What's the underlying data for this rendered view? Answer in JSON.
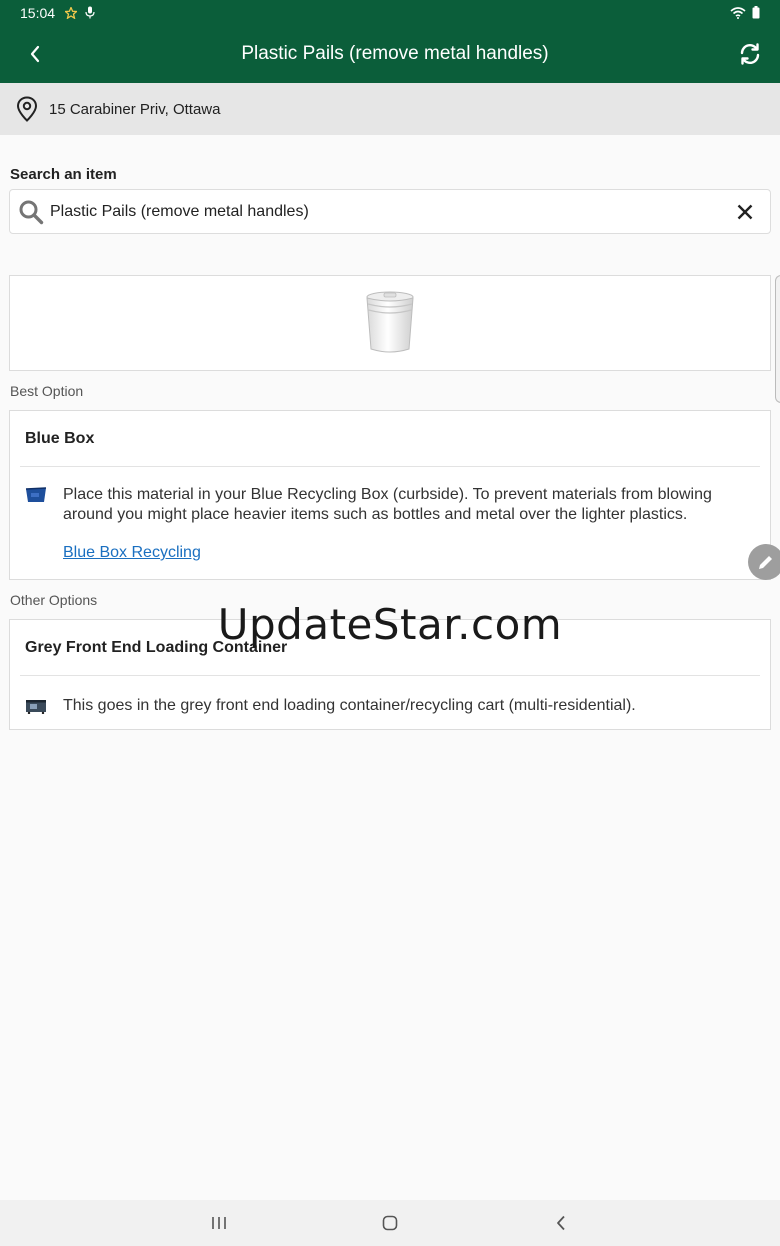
{
  "status_bar": {
    "time": "15:04"
  },
  "app_bar": {
    "title": "Plastic Pails (remove metal handles)"
  },
  "location": {
    "address": "15 Carabiner Priv, Ottawa"
  },
  "search": {
    "label": "Search an item",
    "value": "Plastic Pails (remove metal handles)"
  },
  "best_option": {
    "section_label": "Best Option",
    "title": "Blue Box",
    "description": "Place this material in your Blue Recycling Box (curbside). To prevent materials from blowing around you might place heavier items such as bottles and metal over the lighter plastics.",
    "link": "Blue Box Recycling",
    "icon": "blue-box-icon"
  },
  "other_options": {
    "section_label": "Other Options",
    "items": [
      {
        "title": "Grey Front End Loading Container",
        "description": "This goes in the grey front end loading container/recycling cart (multi-residential).",
        "icon": "grey-container-icon"
      }
    ]
  },
  "watermark": "UpdateStar.com",
  "colors": {
    "app_bar": "#0b5e3a",
    "link": "#1a6fc0",
    "blue_box": "#1e4f9c"
  }
}
